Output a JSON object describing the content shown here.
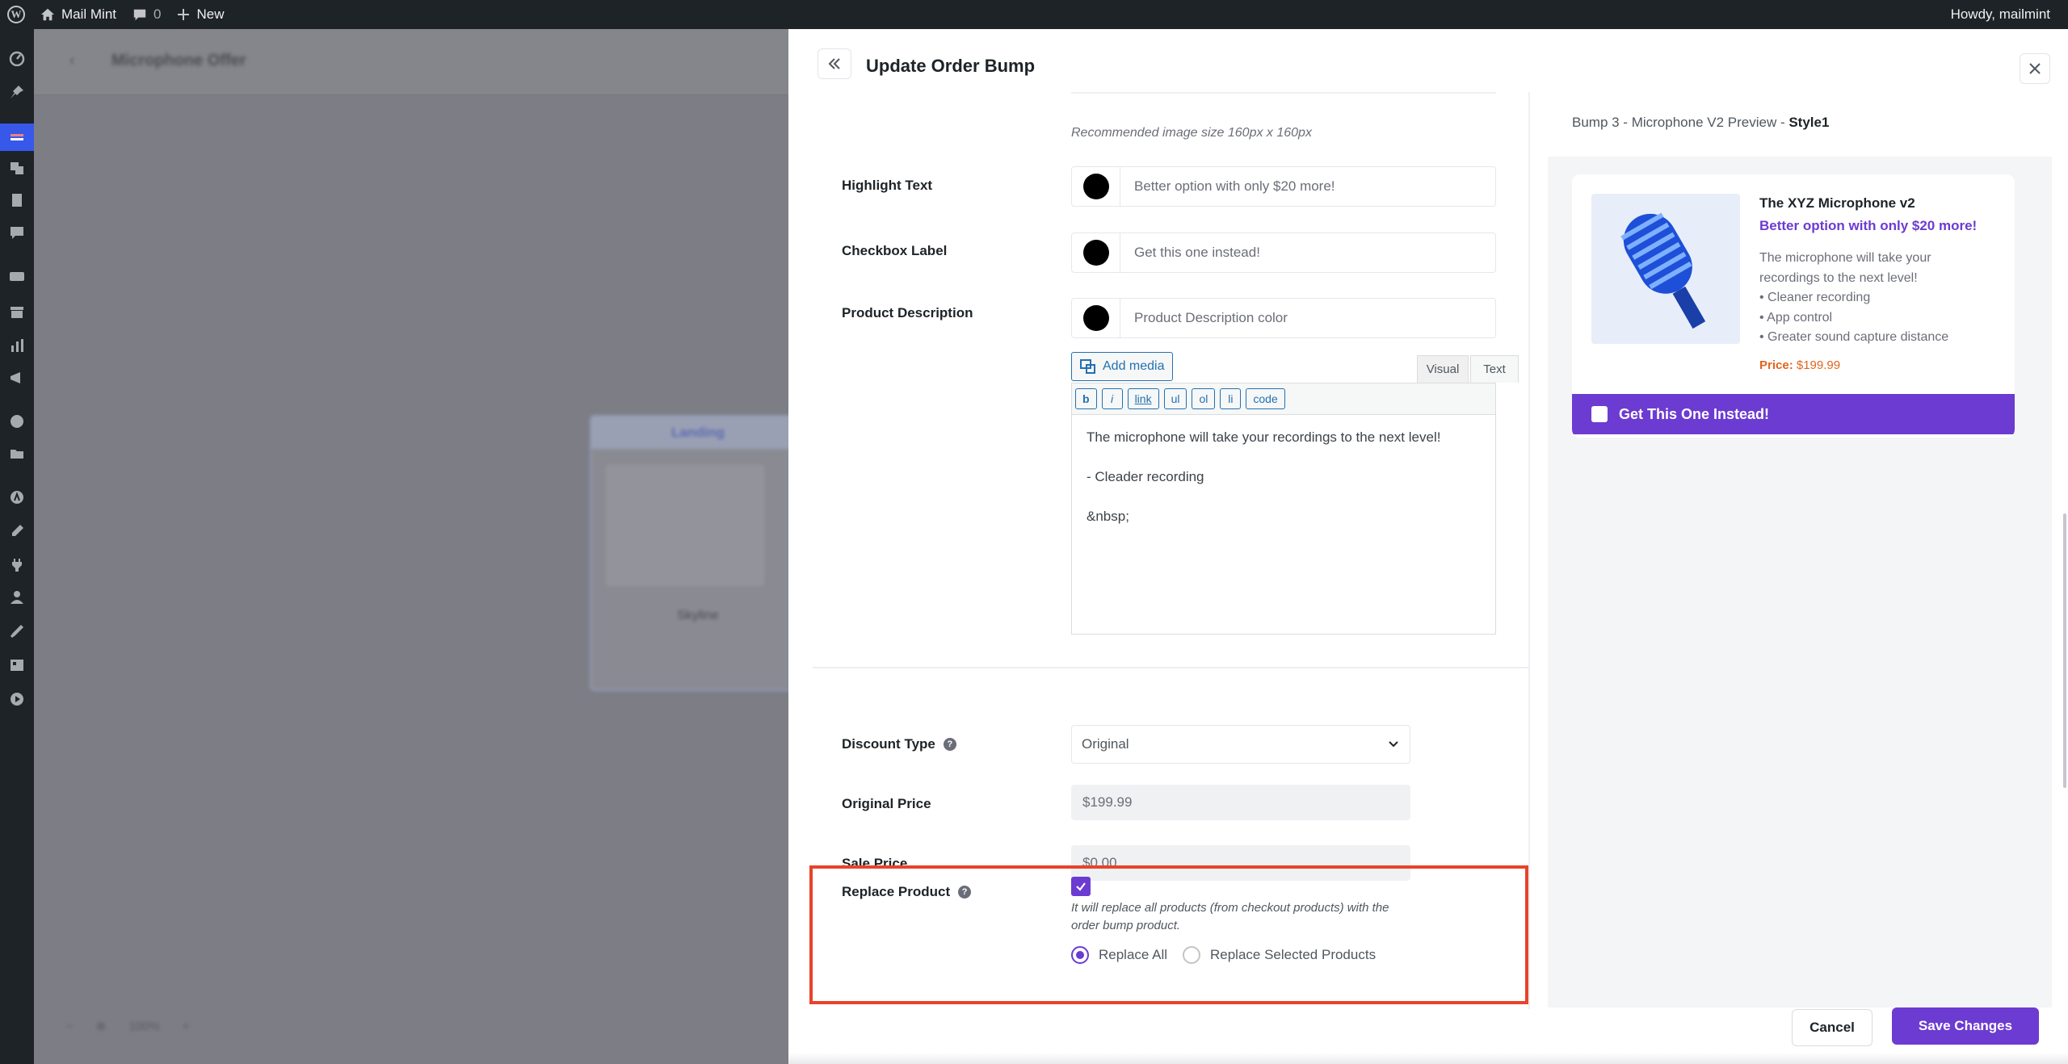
{
  "admin_bar": {
    "site_name": "Mail Mint",
    "comments_count": "0",
    "new_label": "New",
    "howdy": "Howdy, mailmint"
  },
  "background": {
    "builder_title": "Microphone Offer",
    "card_label": "Landing",
    "card_name": "Skyline",
    "zoom": "100%"
  },
  "panel": {
    "title": "Update Order Bump",
    "image_hint": "Recommended image size 160px x 160px",
    "highlight_text": {
      "label": "Highlight Text",
      "placeholder": "Better option with only $20 more!",
      "color": "#000000"
    },
    "checkbox_label": {
      "label": "Checkbox Label",
      "placeholder": "Get this one instead!",
      "color": "#000000"
    },
    "product_description": {
      "label": "Product Description",
      "placeholder": "Product Description color",
      "color": "#000000"
    },
    "editor": {
      "add_media": "Add media",
      "tab_visual": "Visual",
      "tab_text": "Text",
      "quicktags": [
        "b",
        "i",
        "link",
        "ul",
        "ol",
        "li",
        "code"
      ],
      "content_lines": [
        "The microphone will take your recordings to the next level!",
        "- Cleader recording",
        "&nbsp;"
      ]
    },
    "discount_type": {
      "label": "Discount Type",
      "value": "Original"
    },
    "original_price": {
      "label": "Original Price",
      "value": "$199.99"
    },
    "sale_price": {
      "label": "Sale Price",
      "value": "$0.00"
    },
    "replace_product": {
      "label": "Replace Product",
      "checked": true,
      "description": "It will replace all products (from checkout products) with the order bump product.",
      "option_all": "Replace All",
      "option_selected": "Replace Selected Products",
      "selected": "Replace All"
    },
    "cancel_label": "Cancel",
    "save_label": "Save Changes"
  },
  "preview": {
    "title_prefix": "Bump 3 - Microphone V2 Preview - ",
    "style": "Style1",
    "product_name": "The XYZ Microphone v2",
    "highlight": "Better option with only $20 more!",
    "description": "The microphone will take your recordings to the next level!",
    "bullets": [
      "• Cleaner recording",
      "• App control",
      "• Greater sound capture distance"
    ],
    "price_label": "Price:",
    "price_value": "$199.99",
    "checkbox_text": "Get This One Instead!"
  },
  "colors": {
    "accent": "#6c3bd1",
    "highlight_border": "#e8432b",
    "price": "#e0651c",
    "admin_bar": "#1d2327"
  }
}
